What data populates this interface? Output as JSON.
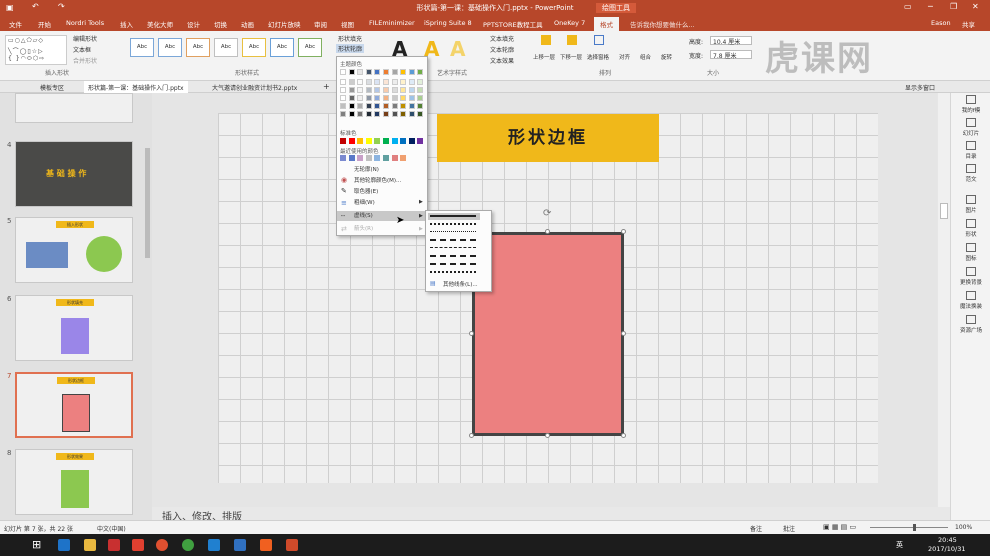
{
  "titlebar": {
    "title": "形状篇-第一课：基础操作入门.pptx - PowerPoint",
    "context_tab": "绘图工具",
    "user": "Eason",
    "share": "共享"
  },
  "tabs": [
    "文件",
    "开始",
    "Nordri Tools",
    "插入",
    "美化大师",
    "设计",
    "切换",
    "动画",
    "幻灯片放映",
    "审阅",
    "视图",
    "FILEminimizer",
    "iSpring Suite 8",
    "PPTSTORE教程工具",
    "OneKey 7",
    "格式"
  ],
  "tell_me": "告诉我你想要做什么...",
  "ribbon": {
    "edit_shape": "编辑形状",
    "text_box": "文本框",
    "merge_shapes": "合并形状",
    "group_insert_shapes": "插入形状",
    "group_shape_styles": "形状样式",
    "group_wordart": "艺术字样式",
    "group_arrange": "排列",
    "group_size": "大小",
    "style_sample": "Abc",
    "shape_fill": "形状填充",
    "shape_outline": "形状轮廓",
    "wordart_sample": "A",
    "text_fill": "文本填充",
    "text_outline": "文本轮廓",
    "text_effect": "文本效果",
    "bring_forward": "上移一层",
    "send_backward": "下移一层",
    "selection_pane": "选择窗格",
    "align": "对齐",
    "group": "组合",
    "rotate": "旋转",
    "height_label": "高度:",
    "height_value": "10.4 厘米",
    "width_label": "宽度:",
    "width_value": "7.8 厘米"
  },
  "doctabs": [
    "模板专区",
    "形状篇-第一课：基础操作入门.pptx",
    "大气邀请创业融资计划书2.pptx"
  ],
  "show_multi": "显示多窗口",
  "thumbnails": [
    {
      "num": "4",
      "text": "基 础 操 作"
    },
    {
      "num": "5",
      "badge": "插入形状"
    },
    {
      "num": "6",
      "badge": "形状填充"
    },
    {
      "num": "7",
      "badge": "形状边框"
    },
    {
      "num": "8",
      "badge": "形状效果"
    }
  ],
  "slide": {
    "title": "形状边框"
  },
  "outline_menu": {
    "theme_colors": "主题颜色",
    "standard_colors": "标准色",
    "recent_colors": "最近使用的颜色",
    "no_outline": "无轮廓(N)",
    "more_colors": "其他轮廓颜色(M)...",
    "eyedropper": "取色器(E)",
    "weight": "粗细(W)",
    "dashes": "虚线(S)",
    "arrows": "箭头(R)",
    "theme_palette": [
      "#ffffff",
      "#000000",
      "#e7e6e6",
      "#44546a",
      "#4472c4",
      "#ed7d31",
      "#a5a5a5",
      "#ffc000",
      "#5b9bd5",
      "#70ad47"
    ],
    "standard_palette": [
      "#c00000",
      "#ff0000",
      "#ffc000",
      "#ffff00",
      "#92d050",
      "#00b050",
      "#00b0f0",
      "#0070c0",
      "#002060",
      "#7030a0"
    ],
    "recent_palette": [
      "#7b8ad0",
      "#5a78c8",
      "#c8a0c8",
      "#c0c0c0",
      "#8cb4e0",
      "#60a0a0",
      "#e08080",
      "#f0a070"
    ]
  },
  "dash_submenu": {
    "more_lines": "其他线条(L)..."
  },
  "right_pane": [
    "我的f模",
    "幻灯片",
    "目录",
    "范文",
    "图片",
    "形状",
    "图标",
    "更换背景",
    "魔法换装",
    "资源广场"
  ],
  "notes": "插入、修改、排版",
  "status": {
    "slide_info": "幻灯片 第 7 张，共 22 张",
    "language": "中文(中国)",
    "notes_btn": "备注",
    "comments_btn": "批注",
    "zoom": "100%"
  },
  "taskbar": {
    "lang": "英",
    "time": "20:45",
    "date": "2017/10/31"
  },
  "watermark": "虎课网"
}
